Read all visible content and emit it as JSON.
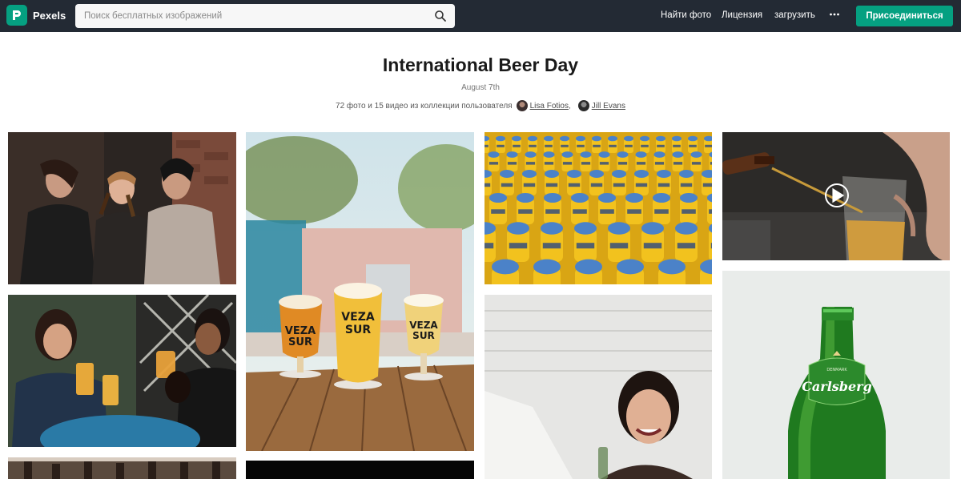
{
  "nav": {
    "brand": "Pexels",
    "search_placeholder": "Поиск бесплатных изображений",
    "links": [
      "Найти фото",
      "Лицензия",
      "загрузить"
    ],
    "more_label": "•••",
    "join_label": "Присоединиться",
    "accent": "#05a081",
    "background": "#232a34"
  },
  "collection": {
    "title": "International Beer Day",
    "subtitle": "August 7th",
    "counts": "72 фото и 15 видео из коллекции пользователя",
    "authors": [
      "Lisa Fotios",
      "Jill Evans"
    ],
    "separator": ","
  },
  "icons": {
    "logo": "pexels-logo-icon",
    "search": "search-icon",
    "more": "more-dots-icon",
    "play": "play-video-icon"
  }
}
